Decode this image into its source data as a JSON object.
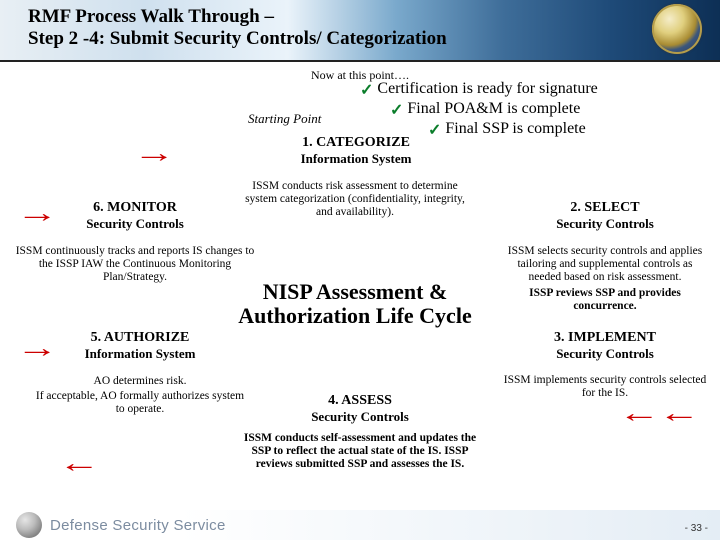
{
  "header": {
    "title_line1": "RMF Process Walk Through –",
    "title_line2": "Step 2 -4:  Submit Security Controls/ Categorization"
  },
  "intro": "Now at this point….",
  "bullets": {
    "b1": "Certification is ready for signature",
    "b2": "Final POA&M is complete",
    "b3": "Final SSP is complete"
  },
  "starting_point": "Starting Point",
  "center_title": "NISP Assessment & Authorization Life Cycle",
  "steps": {
    "s1": {
      "hd": "1. CATEGORIZE",
      "sub": "Information System",
      "desc": "ISSM conducts risk assessment to determine system categorization (confidentiality, integrity, and availability)."
    },
    "s2": {
      "hd": "2. SELECT",
      "sub": "Security Controls",
      "desc": "ISSM selects security controls and applies tailoring and supplemental controls as needed based on risk assessment.",
      "desc2": "ISSP reviews SSP and provides concurrence."
    },
    "s3": {
      "hd": "3. IMPLEMENT",
      "sub": "Security Controls",
      "desc": "ISSM implements security controls selected for the IS."
    },
    "s4": {
      "hd": "4. ASSESS",
      "sub": "Security Controls",
      "desc": "ISSM conducts self-assessment and updates the SSP to reflect the actual state of the IS. ISSP reviews submitted SSP and assesses the IS."
    },
    "s5": {
      "hd": "5. AUTHORIZE",
      "sub": "Information System",
      "desc": "AO determines risk.",
      "desc2": "If acceptable, AO formally authorizes system to operate."
    },
    "s6": {
      "hd": "6. MONITOR",
      "sub": "Security Controls",
      "desc": "ISSM continuously tracks and reports IS changes to the ISSP IAW the Continuous Monitoring Plan/Strategy."
    }
  },
  "footer": {
    "text": "Defense Security Service",
    "page": "- 33 -"
  }
}
